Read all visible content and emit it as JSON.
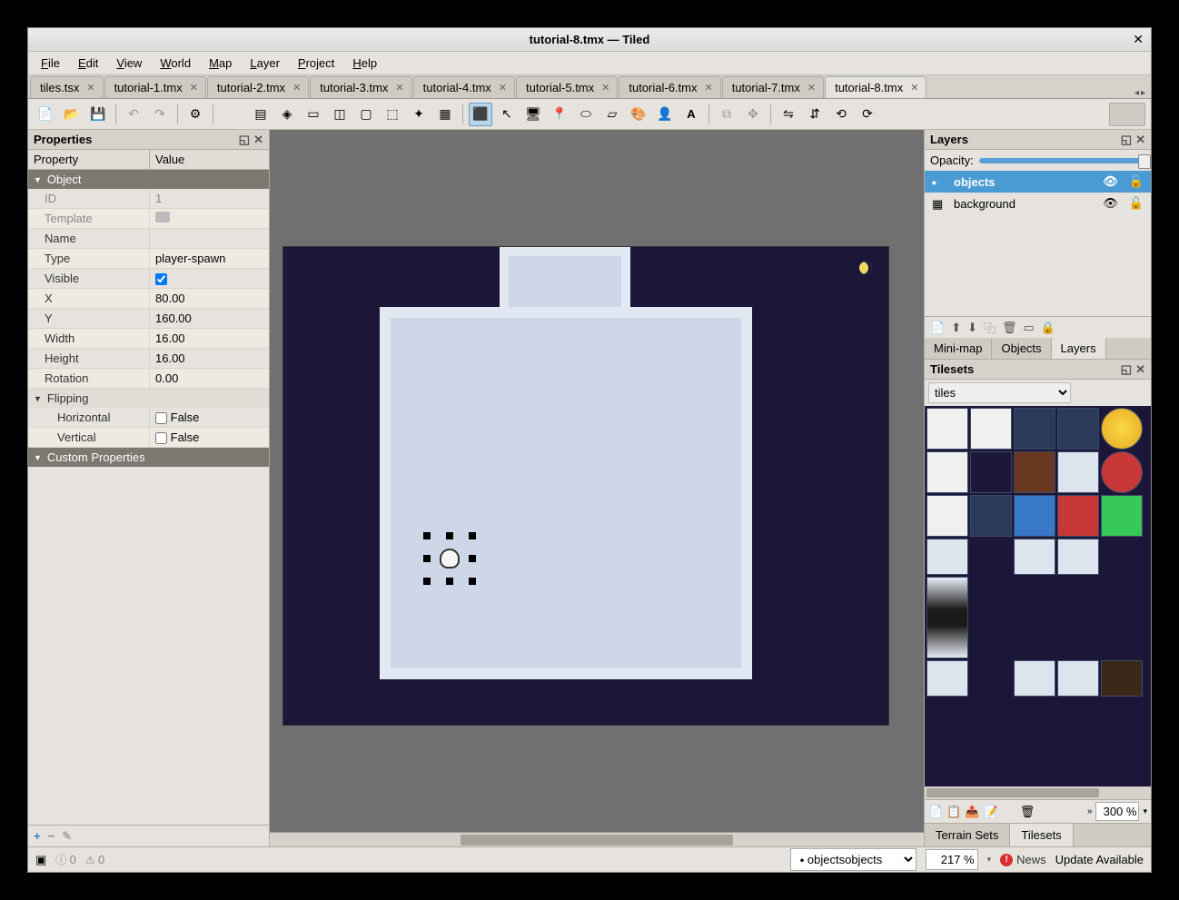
{
  "window": {
    "title": "tutorial-8.tmx — Tiled"
  },
  "menu": {
    "file": "File",
    "edit": "Edit",
    "view": "View",
    "world": "World",
    "map": "Map",
    "layer": "Layer",
    "project": "Project",
    "help": "Help"
  },
  "tabs": [
    {
      "label": "tiles.tsx"
    },
    {
      "label": "tutorial-1.tmx"
    },
    {
      "label": "tutorial-2.tmx"
    },
    {
      "label": "tutorial-3.tmx"
    },
    {
      "label": "tutorial-4.tmx"
    },
    {
      "label": "tutorial-5.tmx"
    },
    {
      "label": "tutorial-6.tmx"
    },
    {
      "label": "tutorial-7.tmx"
    },
    {
      "label": "tutorial-8.tmx",
      "active": true
    }
  ],
  "properties": {
    "title": "Properties",
    "col_property": "Property",
    "col_value": "Value",
    "group_object": "Object",
    "id_k": "ID",
    "id_v": "1",
    "template_k": "Template",
    "template_v": "",
    "name_k": "Name",
    "name_v": "",
    "type_k": "Type",
    "type_v": "player-spawn",
    "visible_k": "Visible",
    "visible_v": true,
    "x_k": "X",
    "x_v": "80.00",
    "y_k": "Y",
    "y_v": "160.00",
    "width_k": "Width",
    "width_v": "16.00",
    "height_k": "Height",
    "height_v": "16.00",
    "rotation_k": "Rotation",
    "rotation_v": "0.00",
    "group_flipping": "Flipping",
    "flip_h_k": "Horizontal",
    "flip_h_v": "False",
    "flip_v_k": "Vertical",
    "flip_v_v": "False",
    "group_custom": "Custom Properties"
  },
  "layers": {
    "title": "Layers",
    "opacity_label": "Opacity:",
    "items": [
      {
        "name": "objects",
        "selected": true
      },
      {
        "name": "background",
        "selected": false
      }
    ],
    "mini_tabs": {
      "minimap": "Mini-map",
      "objects": "Objects",
      "layers": "Layers"
    }
  },
  "tilesets": {
    "title": "Tilesets",
    "selected": "tiles",
    "zoom": "300 %",
    "bottom_tabs": {
      "terrain": "Terrain Sets",
      "tilesets": "Tilesets"
    }
  },
  "status": {
    "errors": "0",
    "warnings": "0",
    "layer_select": "objects",
    "zoom": "217 %",
    "news": "News",
    "update": "Update Available"
  }
}
